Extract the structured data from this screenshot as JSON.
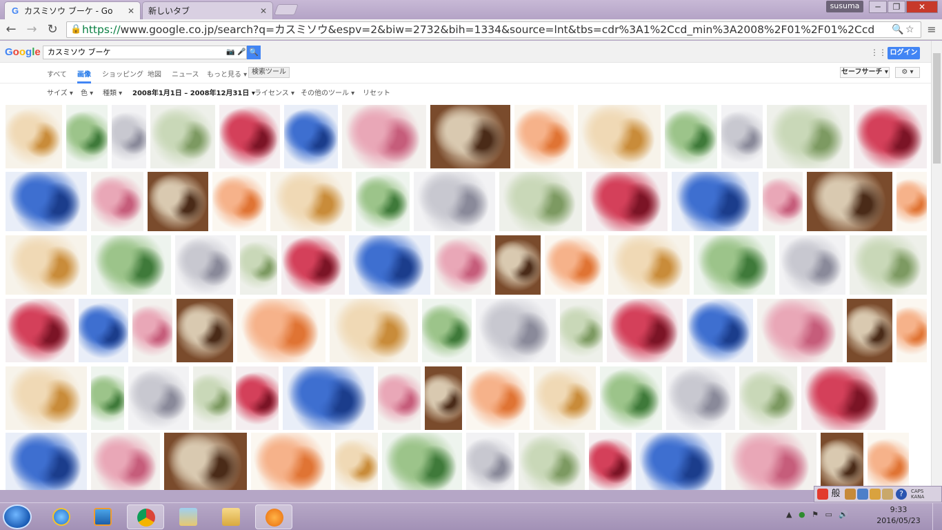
{
  "browser": {
    "tabs": [
      {
        "title": "カスミソウ ブーケ - Go",
        "favicon": "G",
        "active": true
      },
      {
        "title": "新しいタブ",
        "active": false
      }
    ],
    "user": "susuma",
    "url_scheme": "https://",
    "url_rest": "www.google.co.jp/search?q=カスミソウ&espv=2&biw=2732&bih=1334&source=lnt&tbs=cdr%3A1%2Ccd_min%3A2008%2F01%2F01%2Ccd"
  },
  "google": {
    "logo": "Google",
    "query": "カスミソウ ブーケ",
    "login_label": "ログイン",
    "tabs": [
      "すべて",
      "画像",
      "ショッピング",
      "地図",
      "ニュース",
      "もっと見る ▾"
    ],
    "active_tab": "画像",
    "tools_label": "検索ツール",
    "safesearch_label": "セーフサーチ ▾",
    "settings_label": "⚙ ▾",
    "filters": [
      "サイズ ▾",
      "色 ▾",
      "種類 ▾",
      "2008年1月1日 – 2008年12月31日 ▾",
      "ライセンス ▾",
      "その他のツール ▾",
      "リセット"
    ]
  },
  "colors": {
    "accent": "#4285f4",
    "link_green": "#0b8043"
  },
  "taskbar": {
    "time": "9:33",
    "date": "2016/05/23",
    "ime_label_1": "CAPS",
    "ime_label_2": "KANA",
    "ime_char": "般"
  }
}
